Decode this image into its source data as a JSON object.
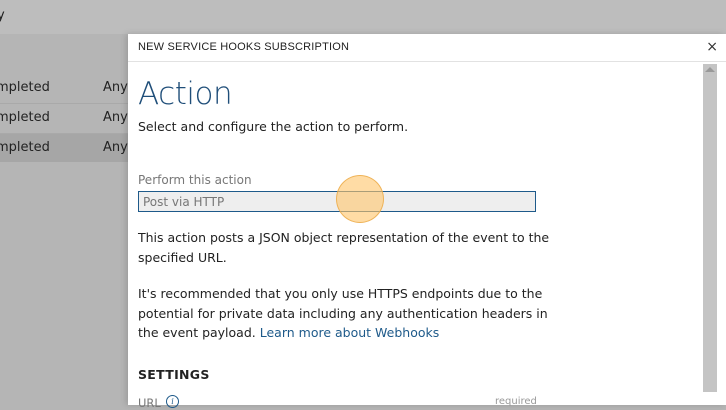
{
  "background": {
    "title_fragment": "y",
    "rows": [
      {
        "status": "mpleted",
        "scope": "Any"
      },
      {
        "status": "mpleted",
        "scope": "Any"
      },
      {
        "status": "mpleted",
        "scope": "Any"
      }
    ]
  },
  "dialog": {
    "header_title": "NEW SERVICE HOOKS SUBSCRIPTION",
    "close_glyph": "×",
    "heading": "Action",
    "subheading": "Select and configure the action to perform.",
    "perform_label": "Perform this action",
    "perform_value": "Post via HTTP",
    "description": "This action posts a JSON object representation of the event to the specified URL.",
    "recommendation": "It's recommended that you only use HTTPS endpoints due to the potential for private data including any authentication headers in the event payload.",
    "learn_more_link": "Learn more about Webhooks",
    "settings_heading": "SETTINGS",
    "url_label": "URL",
    "url_info_icon": "i",
    "url_required": "required"
  },
  "colors": {
    "accent": "#1e5a8a",
    "heading": "#1f4e79",
    "cursor_highlight": "#ffc76e"
  },
  "icons": {
    "close": "close-icon",
    "info": "info-icon",
    "scroll_up": "scroll-up-arrow-icon"
  }
}
